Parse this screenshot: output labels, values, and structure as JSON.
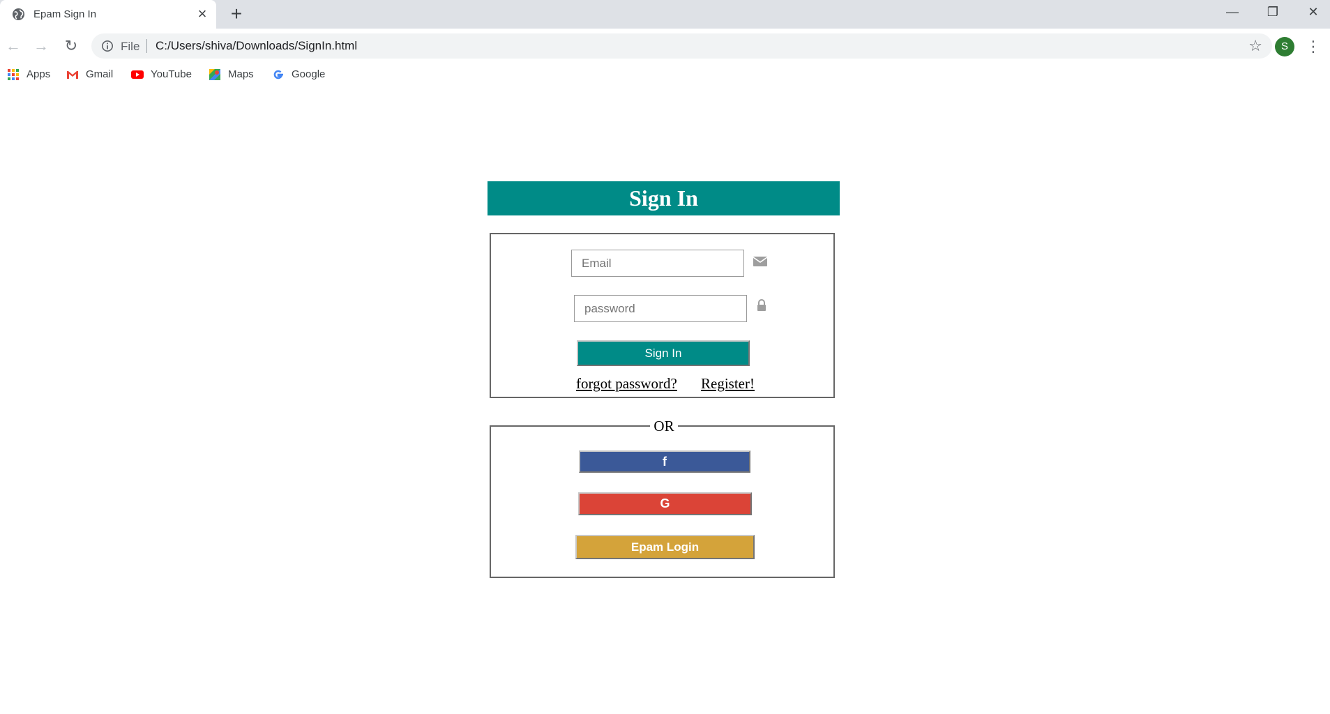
{
  "browser": {
    "tab_title": "Epam Sign In",
    "url_scheme": "File",
    "url": "C:/Users/shiva/Downloads/SignIn.html",
    "profile_initial": "S",
    "bookmarks": [
      {
        "label": "Apps",
        "icon": "apps-grid-icon"
      },
      {
        "label": "Gmail",
        "icon": "gmail-icon"
      },
      {
        "label": "YouTube",
        "icon": "youtube-icon"
      },
      {
        "label": "Maps",
        "icon": "maps-icon"
      },
      {
        "label": "Google",
        "icon": "google-icon"
      }
    ]
  },
  "page": {
    "heading": "Sign In",
    "email_placeholder": "Email",
    "password_placeholder": "password",
    "signin_button": "Sign In",
    "forgot_link": "forgot password?",
    "register_link": "Register!",
    "or_label": "OR",
    "facebook_button": "f",
    "google_button": "G",
    "epam_button": "Epam Login"
  },
  "colors": {
    "accent": "#008b87",
    "facebook": "#3b5998",
    "google": "#db4437",
    "epam": "#d4a33a"
  }
}
